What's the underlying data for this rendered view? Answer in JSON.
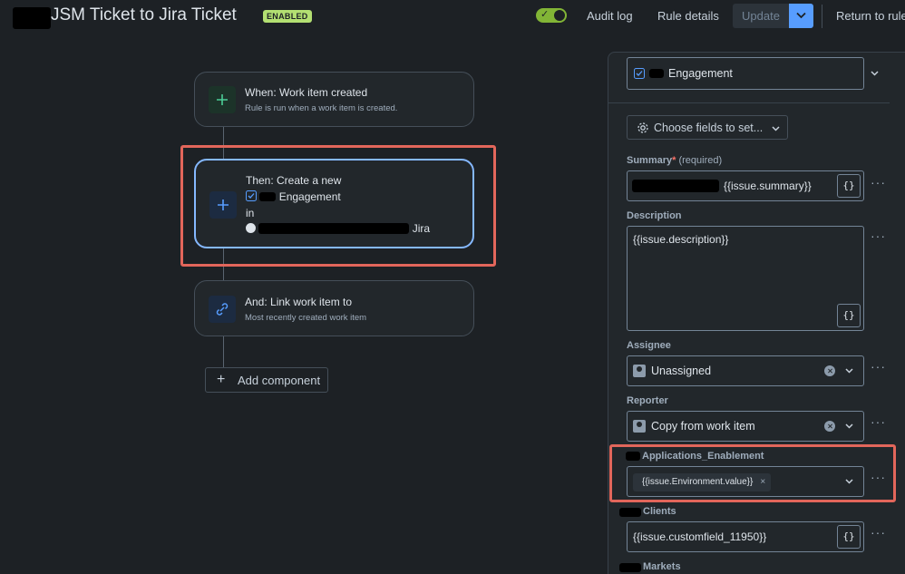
{
  "header": {
    "title": "JSM Ticket to Jira Ticket",
    "status_badge": "ENABLED",
    "audit_log": "Audit log",
    "rule_details": "Rule details",
    "update": "Update",
    "return": "Return to rule"
  },
  "flow": {
    "trigger": {
      "title": "When: Work item created",
      "subtitle": "Rule is run when a work item is created."
    },
    "action": {
      "line1": "Then: Create a new",
      "line2": "Engagement",
      "line3": "in",
      "line4": "Jira"
    },
    "link": {
      "title": "And: Link work item to",
      "subtitle": "Most recently created work item"
    },
    "add_component": "Add component"
  },
  "panel": {
    "work_type": "Engagement",
    "choose_fields": "Choose fields to set...",
    "summary": {
      "label": "Summary",
      "required_marker": "*",
      "required_text": "(required)",
      "value": "{{issue.summary}}"
    },
    "description": {
      "label": "Description",
      "value": "{{issue.description}}"
    },
    "assignee": {
      "label": "Assignee",
      "value": "Unassigned"
    },
    "reporter": {
      "label": "Reporter",
      "value": "Copy from work item"
    },
    "applications": {
      "label": "Applications_Enablement",
      "chip": "{{issue.Environment.value}}",
      "chip_remove": "×"
    },
    "clients": {
      "label": "Clients",
      "value": "{{issue.customfield_11950}}"
    },
    "markets": {
      "label": "Markets"
    },
    "brace_label": "{}",
    "more_label": "···"
  },
  "colors": {
    "background": "#1d2125",
    "accent": "#579dff",
    "enabled": "#b3df72",
    "highlight": "#e2665b"
  }
}
